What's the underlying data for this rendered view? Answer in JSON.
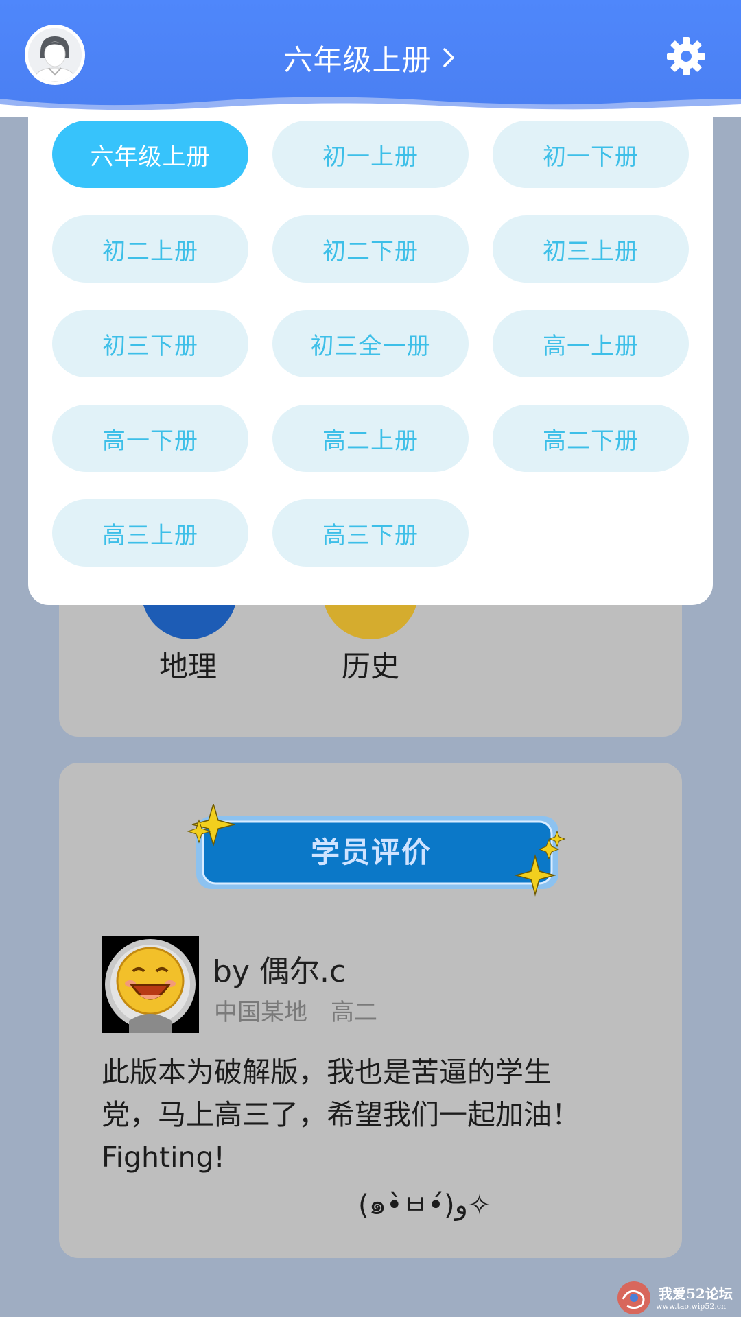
{
  "header": {
    "current_grade": "六年级上册",
    "chevron_icon": "chevron-right-icon",
    "settings_icon": "gear-icon",
    "avatar_icon": "user-avatar-icon",
    "background_color": "#4f87fb"
  },
  "grade_menu": {
    "selected_index": 0,
    "accent_color": "#37c3fb",
    "options": [
      "六年级上册",
      "初一上册",
      "初一下册",
      "初二上册",
      "初二下册",
      "初三上册",
      "初三下册",
      "初三全一册",
      "高一上册",
      "高一下册",
      "高二上册",
      "高二下册",
      "高三上册",
      "高三下册"
    ]
  },
  "subjects": {
    "items": [
      {
        "label": "地理",
        "color": "#1d5cb5"
      },
      {
        "label": "历史",
        "color": "#d5ac2e"
      }
    ]
  },
  "review": {
    "badge_title": "学员评价",
    "reviewer_name": "by 偶尔.c",
    "location": "中国某地",
    "grade": "高二",
    "text_line1": "此版本为破解版，我也是苦逼的学生",
    "text_line2": "党，马上高三了，希望我们一起加油！",
    "text_line3": "Fighting!",
    "kaomoji": "(๑•̀ㅂ•́)و✧"
  },
  "watermark": {
    "text": "我爱52论坛",
    "url": "www.tao.wip52.cn"
  }
}
